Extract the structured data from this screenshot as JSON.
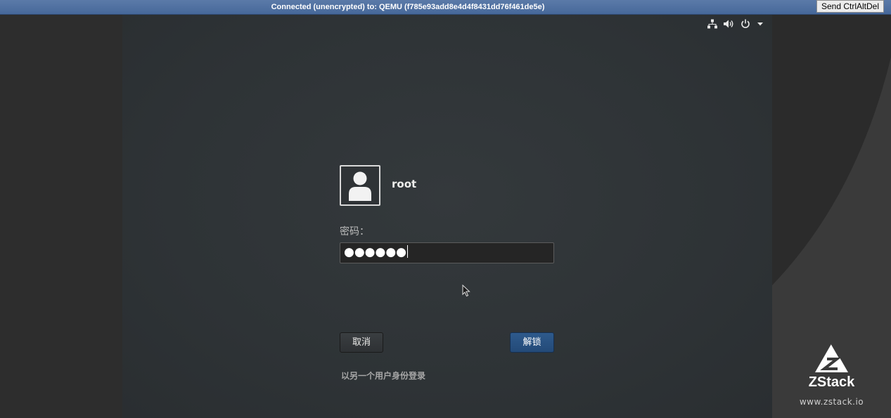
{
  "topbar": {
    "connection_status": "Connected (unencrypted) to: QEMU (f785e93add8e4d4f8431dd76f461de5e)",
    "send_cad_label": "Send CtrlAltDel"
  },
  "status_area": {
    "icons": [
      "network-icon",
      "volume-icon",
      "power-icon",
      "chevron-down-icon"
    ]
  },
  "login": {
    "username": "root",
    "password_label": "密码：",
    "password_value": "●●●●●●",
    "cancel_label": "取消",
    "unlock_label": "解锁",
    "switch_user_label": "以另一个用户身份登录"
  },
  "branding": {
    "name": "ZStack",
    "url": "www.zstack.io"
  },
  "colors": {
    "topbar": "#4f70a1",
    "unlock_button": "#2a5282",
    "screen_bg": "#2e3336"
  }
}
